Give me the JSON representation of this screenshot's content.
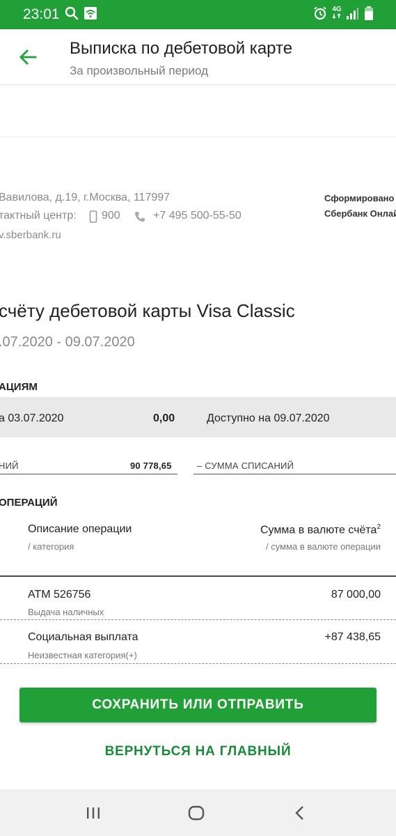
{
  "status_bar": {
    "time": "23:01",
    "network": "4G"
  },
  "header": {
    "title": "Выписка по дебетовой карте",
    "subtitle": "За произвольный период"
  },
  "document": {
    "address": "Вавилова, д.19, г.Москва, 117997",
    "contact_label": "тактный центр:",
    "phone_short": "900",
    "phone_long": "+7 495 500-55-50",
    "website": "v.sberbank.ru",
    "formed_line1": "Сформировано",
    "formed_line2": "Сбербанк Онлай",
    "heading": "счёту дебетовой карты Visa Classic",
    "period": ".07.2020 - 09.07.2020",
    "ops_section": "АЦИЯМ",
    "balance_label": "а 03.07.2020",
    "balance_value": "0,00",
    "available_label": "Доступно на 09.07.2020",
    "credits_label": "НИЙ",
    "credits_value": "90 778,65",
    "debits_label": "– СУММА СПИСАНИЙ",
    "ops_list_section": "ОПЕРАЦИЙ",
    "col_desc": "Описание операции",
    "col_desc_sub": "/ категория",
    "col_amount": "Сумма в валюте счёта",
    "col_amount_sup": "2",
    "col_amount_sub": "/ сумма в валюте операции",
    "operations": [
      {
        "title": "ATM 526756",
        "category": "Выдача наличных",
        "amount": "87 000,00"
      },
      {
        "title": "Социальная выплата",
        "category": "Неизвестная категория(+)",
        "amount": "+87 438,65"
      }
    ]
  },
  "actions": {
    "primary": "СОХРАНИТЬ ИЛИ ОТПРАВИТЬ",
    "secondary": "ВЕРНУТЬСЯ НА ГЛАВНЫЙ"
  },
  "colors": {
    "brand_green": "#21a038",
    "link_green": "#1a8a3a"
  }
}
